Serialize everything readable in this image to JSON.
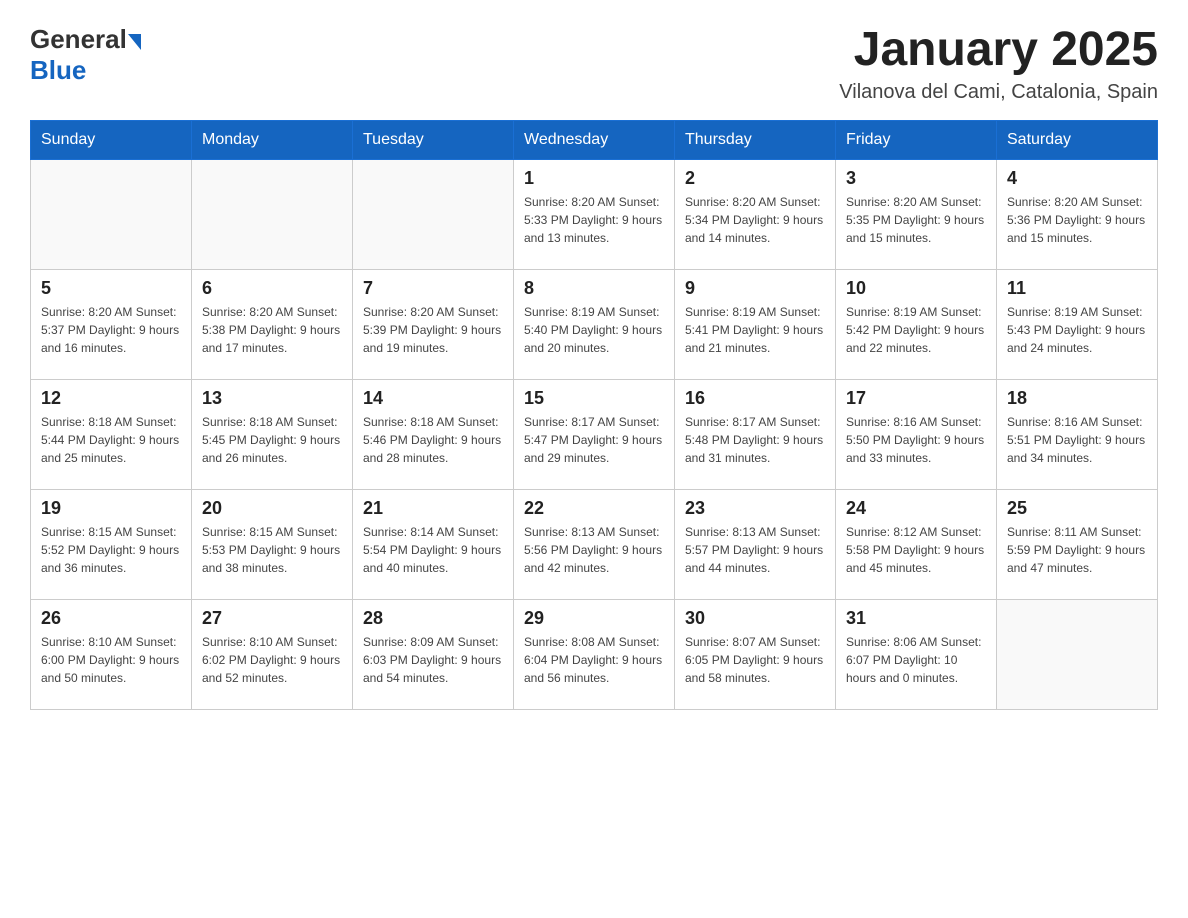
{
  "header": {
    "title": "January 2025",
    "subtitle": "Vilanova del Cami, Catalonia, Spain",
    "logo_general": "General",
    "logo_blue": "Blue"
  },
  "days_of_week": [
    "Sunday",
    "Monday",
    "Tuesday",
    "Wednesday",
    "Thursday",
    "Friday",
    "Saturday"
  ],
  "weeks": [
    [
      {
        "day": "",
        "info": ""
      },
      {
        "day": "",
        "info": ""
      },
      {
        "day": "",
        "info": ""
      },
      {
        "day": "1",
        "info": "Sunrise: 8:20 AM\nSunset: 5:33 PM\nDaylight: 9 hours and 13 minutes."
      },
      {
        "day": "2",
        "info": "Sunrise: 8:20 AM\nSunset: 5:34 PM\nDaylight: 9 hours and 14 minutes."
      },
      {
        "day": "3",
        "info": "Sunrise: 8:20 AM\nSunset: 5:35 PM\nDaylight: 9 hours and 15 minutes."
      },
      {
        "day": "4",
        "info": "Sunrise: 8:20 AM\nSunset: 5:36 PM\nDaylight: 9 hours and 15 minutes."
      }
    ],
    [
      {
        "day": "5",
        "info": "Sunrise: 8:20 AM\nSunset: 5:37 PM\nDaylight: 9 hours and 16 minutes."
      },
      {
        "day": "6",
        "info": "Sunrise: 8:20 AM\nSunset: 5:38 PM\nDaylight: 9 hours and 17 minutes."
      },
      {
        "day": "7",
        "info": "Sunrise: 8:20 AM\nSunset: 5:39 PM\nDaylight: 9 hours and 19 minutes."
      },
      {
        "day": "8",
        "info": "Sunrise: 8:19 AM\nSunset: 5:40 PM\nDaylight: 9 hours and 20 minutes."
      },
      {
        "day": "9",
        "info": "Sunrise: 8:19 AM\nSunset: 5:41 PM\nDaylight: 9 hours and 21 minutes."
      },
      {
        "day": "10",
        "info": "Sunrise: 8:19 AM\nSunset: 5:42 PM\nDaylight: 9 hours and 22 minutes."
      },
      {
        "day": "11",
        "info": "Sunrise: 8:19 AM\nSunset: 5:43 PM\nDaylight: 9 hours and 24 minutes."
      }
    ],
    [
      {
        "day": "12",
        "info": "Sunrise: 8:18 AM\nSunset: 5:44 PM\nDaylight: 9 hours and 25 minutes."
      },
      {
        "day": "13",
        "info": "Sunrise: 8:18 AM\nSunset: 5:45 PM\nDaylight: 9 hours and 26 minutes."
      },
      {
        "day": "14",
        "info": "Sunrise: 8:18 AM\nSunset: 5:46 PM\nDaylight: 9 hours and 28 minutes."
      },
      {
        "day": "15",
        "info": "Sunrise: 8:17 AM\nSunset: 5:47 PM\nDaylight: 9 hours and 29 minutes."
      },
      {
        "day": "16",
        "info": "Sunrise: 8:17 AM\nSunset: 5:48 PM\nDaylight: 9 hours and 31 minutes."
      },
      {
        "day": "17",
        "info": "Sunrise: 8:16 AM\nSunset: 5:50 PM\nDaylight: 9 hours and 33 minutes."
      },
      {
        "day": "18",
        "info": "Sunrise: 8:16 AM\nSunset: 5:51 PM\nDaylight: 9 hours and 34 minutes."
      }
    ],
    [
      {
        "day": "19",
        "info": "Sunrise: 8:15 AM\nSunset: 5:52 PM\nDaylight: 9 hours and 36 minutes."
      },
      {
        "day": "20",
        "info": "Sunrise: 8:15 AM\nSunset: 5:53 PM\nDaylight: 9 hours and 38 minutes."
      },
      {
        "day": "21",
        "info": "Sunrise: 8:14 AM\nSunset: 5:54 PM\nDaylight: 9 hours and 40 minutes."
      },
      {
        "day": "22",
        "info": "Sunrise: 8:13 AM\nSunset: 5:56 PM\nDaylight: 9 hours and 42 minutes."
      },
      {
        "day": "23",
        "info": "Sunrise: 8:13 AM\nSunset: 5:57 PM\nDaylight: 9 hours and 44 minutes."
      },
      {
        "day": "24",
        "info": "Sunrise: 8:12 AM\nSunset: 5:58 PM\nDaylight: 9 hours and 45 minutes."
      },
      {
        "day": "25",
        "info": "Sunrise: 8:11 AM\nSunset: 5:59 PM\nDaylight: 9 hours and 47 minutes."
      }
    ],
    [
      {
        "day": "26",
        "info": "Sunrise: 8:10 AM\nSunset: 6:00 PM\nDaylight: 9 hours and 50 minutes."
      },
      {
        "day": "27",
        "info": "Sunrise: 8:10 AM\nSunset: 6:02 PM\nDaylight: 9 hours and 52 minutes."
      },
      {
        "day": "28",
        "info": "Sunrise: 8:09 AM\nSunset: 6:03 PM\nDaylight: 9 hours and 54 minutes."
      },
      {
        "day": "29",
        "info": "Sunrise: 8:08 AM\nSunset: 6:04 PM\nDaylight: 9 hours and 56 minutes."
      },
      {
        "day": "30",
        "info": "Sunrise: 8:07 AM\nSunset: 6:05 PM\nDaylight: 9 hours and 58 minutes."
      },
      {
        "day": "31",
        "info": "Sunrise: 8:06 AM\nSunset: 6:07 PM\nDaylight: 10 hours and 0 minutes."
      },
      {
        "day": "",
        "info": ""
      }
    ]
  ]
}
